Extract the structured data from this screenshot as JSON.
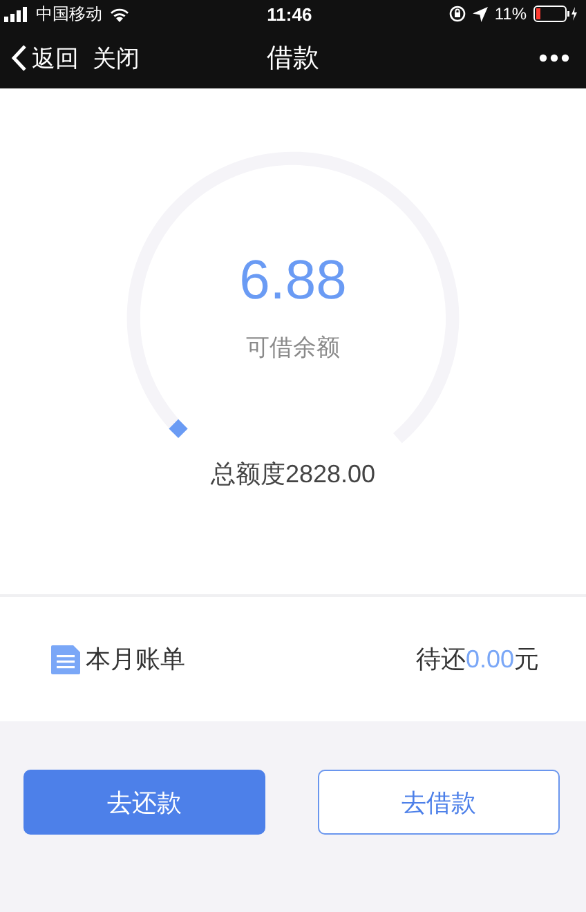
{
  "status_bar": {
    "carrier": "中国移动",
    "time": "11:46",
    "battery": "11%"
  },
  "nav": {
    "back": "返回",
    "close": "关闭",
    "title": "借款"
  },
  "gauge": {
    "amount": "6.88",
    "label": "可借余额",
    "total": "总额度2828.00"
  },
  "bill": {
    "label": "本月账单",
    "due_prefix": "待还",
    "due_amount": "0.00",
    "due_suffix": "元"
  },
  "buttons": [
    {
      "label": "去还款",
      "kind": "primary"
    },
    {
      "label": "去借款",
      "kind": "outline"
    }
  ]
}
